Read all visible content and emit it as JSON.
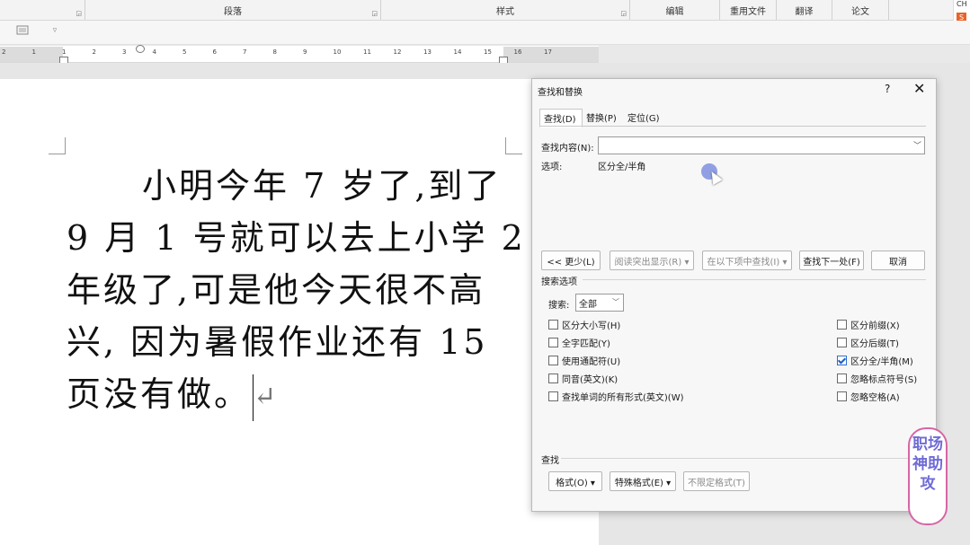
{
  "ribbon": {
    "groups": [
      "段落",
      "样式",
      "编辑",
      "重用文件",
      "翻译",
      "论文"
    ],
    "right_strip": [
      "CH",
      "S"
    ]
  },
  "ruler": {
    "numbers": [
      "2",
      "1",
      "1",
      "2",
      "3",
      "4",
      "5",
      "6",
      "7",
      "8",
      "9",
      "10",
      "11",
      "12",
      "13",
      "14",
      "15",
      "16",
      "17"
    ]
  },
  "document": {
    "lines": [
      "小明今年 7 岁了,到了",
      "9 月 1 号就可以去上小学 2",
      "年级了,可是他今天很不高",
      "兴, 因为暑假作业还有 15",
      "页没有做。"
    ],
    "return_mark": "↵"
  },
  "dialog": {
    "title": "查找和替换",
    "help": "?",
    "close": "✕",
    "tabs": [
      "查找(D)",
      "替换(P)",
      "定位(G)"
    ],
    "find_label": "查找内容(N):",
    "find_value": "",
    "options_label": "选项:",
    "options_value": "区分全/半角",
    "buttons": {
      "less": "<< 更少(L)",
      "reading_highlight": "阅读突出显示(R) ▾",
      "find_in": "在以下项中查找(I) ▾",
      "find_next": "查找下一处(F)",
      "cancel": "取消"
    },
    "search_options_title": "搜索选项",
    "search_label": "搜索:",
    "search_value": "全部",
    "left_checks": [
      {
        "label": "区分大小写(H)",
        "checked": false
      },
      {
        "label": "全字匹配(Y)",
        "checked": false
      },
      {
        "label": "使用通配符(U)",
        "checked": false
      },
      {
        "label": "同音(英文)(K)",
        "checked": false
      },
      {
        "label": "查找单词的所有形式(英文)(W)",
        "checked": false
      }
    ],
    "right_checks": [
      {
        "label": "区分前缀(X)",
        "checked": false
      },
      {
        "label": "区分后缀(T)",
        "checked": false
      },
      {
        "label": "区分全/半角(M)",
        "checked": true
      },
      {
        "label": "忽略标点符号(S)",
        "checked": false
      },
      {
        "label": "忽略空格(A)",
        "checked": false
      }
    ],
    "find_section": "查找",
    "bottom_buttons": {
      "format": "格式(O) ▾",
      "special": "特殊格式(E) ▾",
      "no_format": "不限定格式(T)"
    }
  },
  "watermark": {
    "text": "职场神助攻"
  }
}
